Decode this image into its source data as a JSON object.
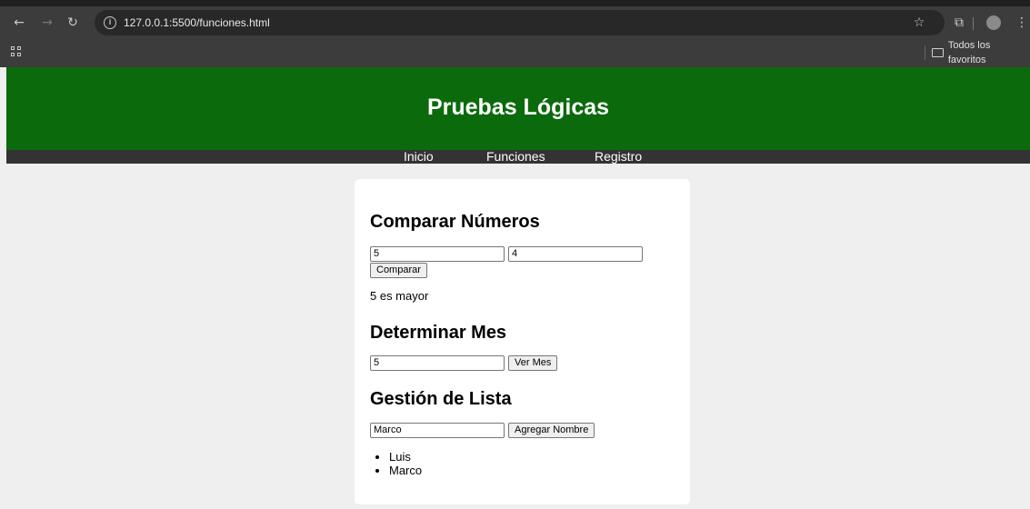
{
  "browser": {
    "url": "127.0.0.1:5500/funciones.html",
    "bookmarks_folder": "Todos los favoritos",
    "accent": "#0b6a0b"
  },
  "header": {
    "title": "Pruebas Lógicas"
  },
  "nav": {
    "items": [
      "Inicio",
      "Funciones",
      "Registro"
    ]
  },
  "compare": {
    "heading": "Comparar Números",
    "input1_value": "5",
    "input2_value": "4",
    "button_label": "Comparar",
    "result": "5 es mayor"
  },
  "month": {
    "heading": "Determinar Mes",
    "input_value": "5",
    "button_label": "Ver Mes"
  },
  "list_section": {
    "heading": "Gestión de Lista",
    "input_value": "Marco",
    "button_label": "Agregar Nombre",
    "items": [
      "Luis",
      "Marco"
    ]
  }
}
